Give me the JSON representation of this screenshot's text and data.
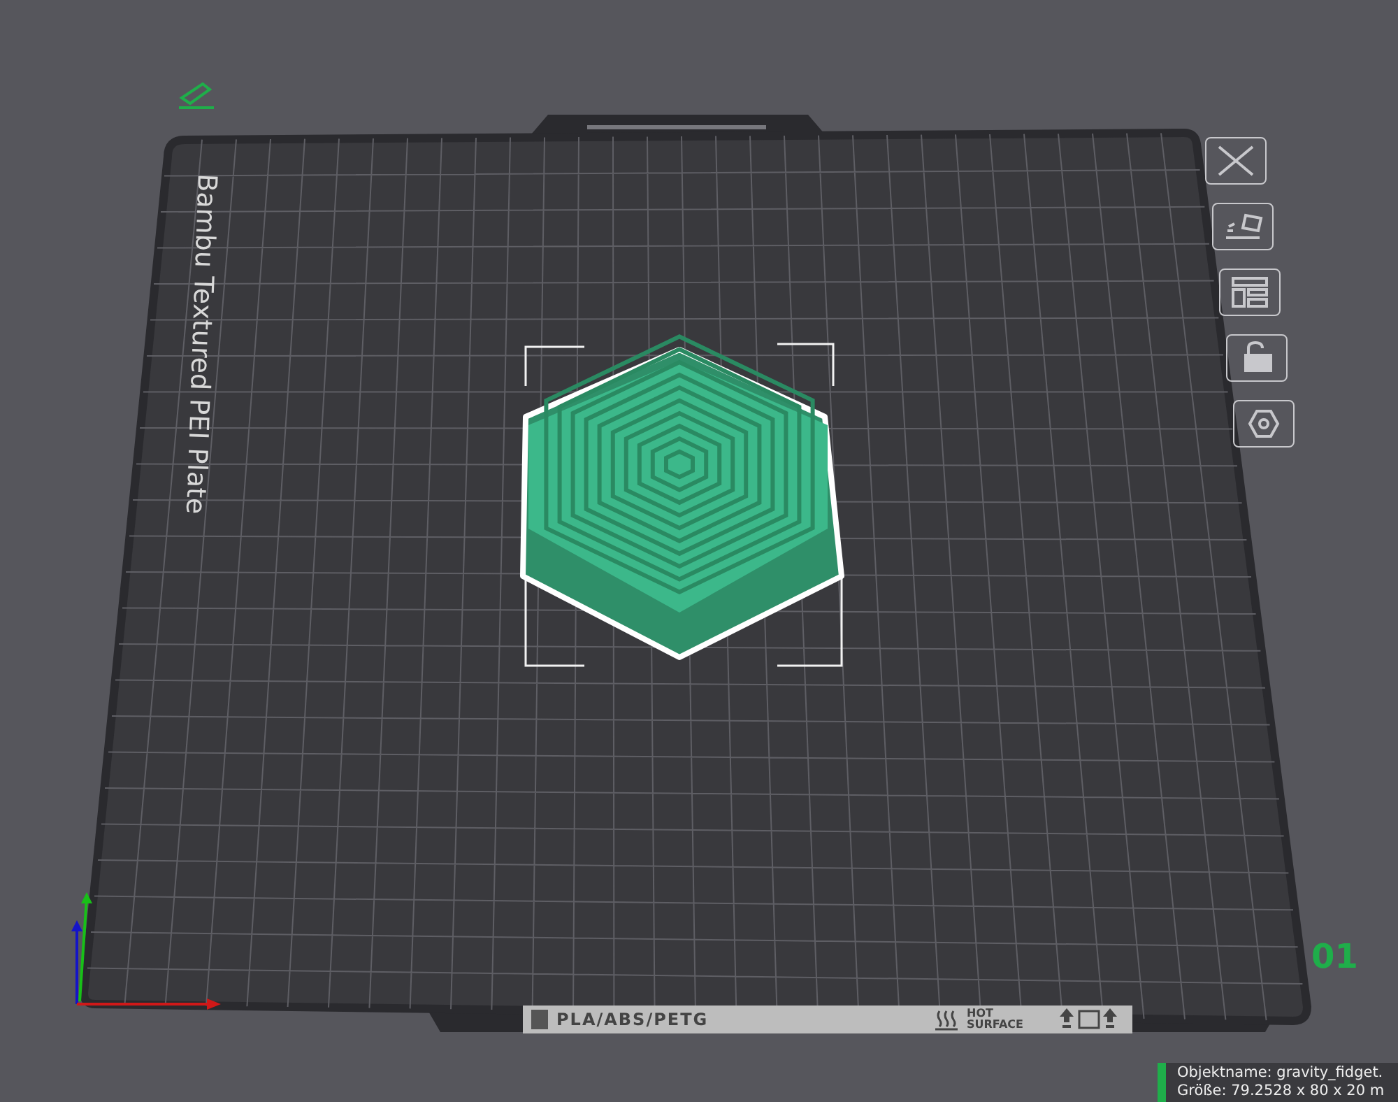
{
  "plate": {
    "name": "Bambu Textured PEI Plate",
    "number": "01"
  },
  "label_strip": {
    "material": "PLA/ABS/PETG",
    "warning": [
      "HOT",
      "SURFACE"
    ]
  },
  "tooltip": {
    "lines": [
      "Objektname: gravity_fidget.",
      "Größe: 79.2528 x 80 x 20 m"
    ]
  }
}
